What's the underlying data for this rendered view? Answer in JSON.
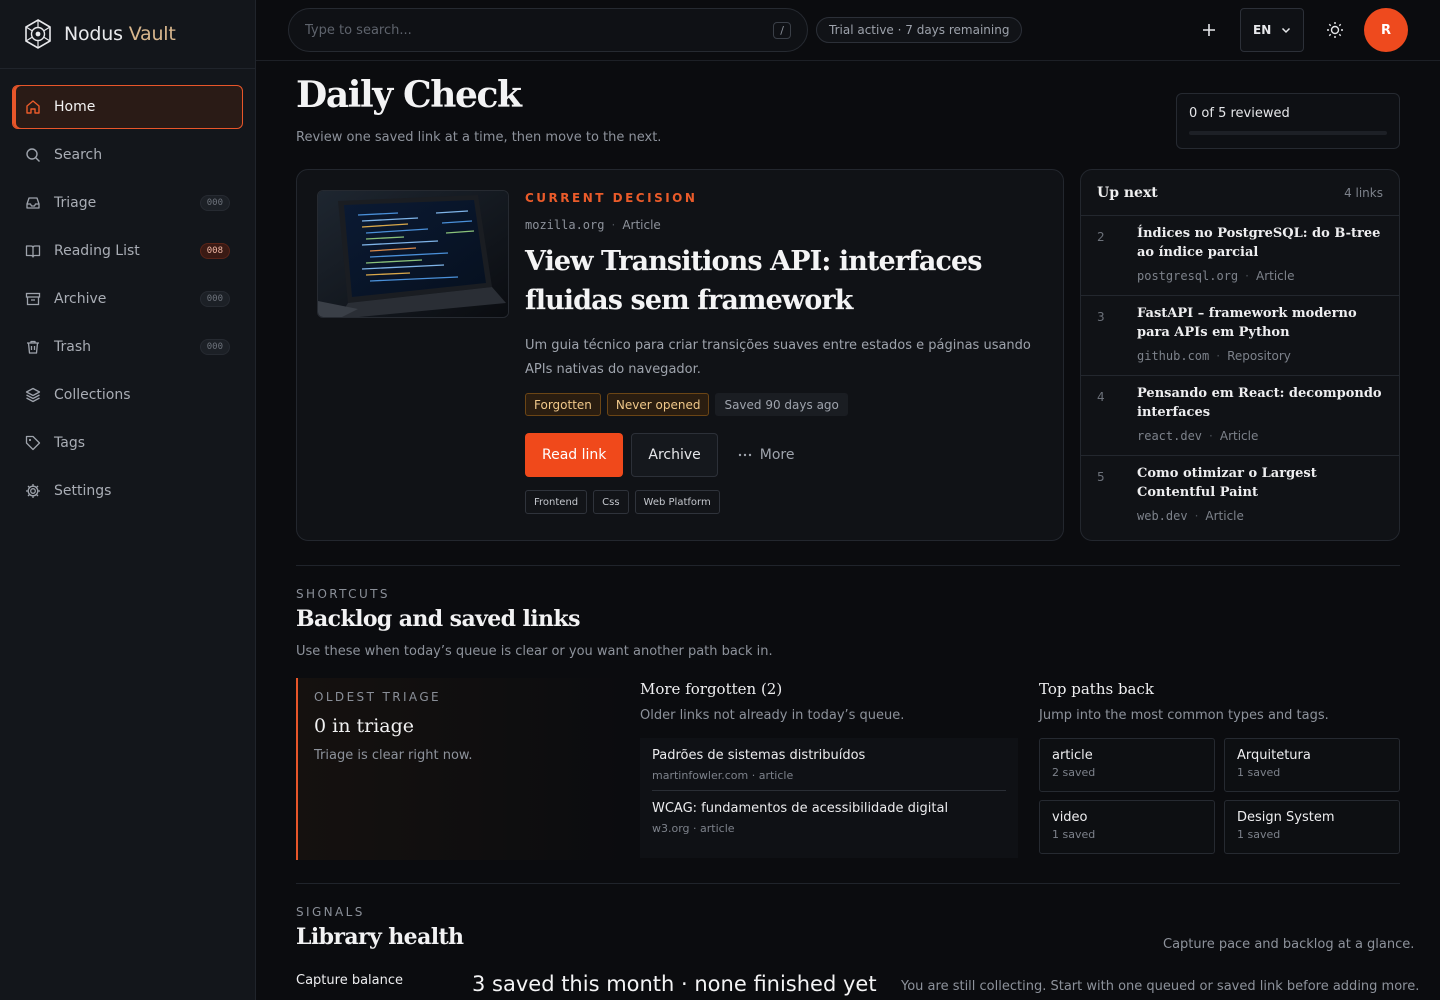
{
  "brand": {
    "name_primary": "Nodus",
    "name_accent": "Vault"
  },
  "sidebar": {
    "items": [
      {
        "label": "Home",
        "icon": "home-icon",
        "active": true
      },
      {
        "label": "Search",
        "icon": "search-icon"
      },
      {
        "label": "Triage",
        "icon": "inbox-icon",
        "badge": "000"
      },
      {
        "label": "Reading List",
        "icon": "book-open-icon",
        "badge": "008"
      },
      {
        "label": "Archive",
        "icon": "archive-icon",
        "badge": "000"
      },
      {
        "label": "Trash",
        "icon": "trash-icon",
        "badge": "000"
      },
      {
        "label": "Collections",
        "icon": "layers-icon"
      },
      {
        "label": "Tags",
        "icon": "tag-icon"
      },
      {
        "label": "Settings",
        "icon": "gear-icon"
      }
    ]
  },
  "topbar": {
    "search_placeholder": "Type to search...",
    "search_shortcut": "/",
    "trial": "Trial active · 7 days remaining",
    "language": "EN",
    "avatar_initial": "R"
  },
  "page": {
    "title": "Daily Check",
    "subtitle": "Review one saved link at a time, then move to the next.",
    "progress_label": "0 of 5 reviewed",
    "progress_fraction": 0
  },
  "decision": {
    "eyebrow": "CURRENT DECISION",
    "domain": "mozilla.org",
    "type": "Article",
    "title": "View Transitions API: interfaces fluidas sem framework",
    "summary": "Um guia técnico para criar transições suaves entre estados e páginas usando APIs nativas do navegador.",
    "badges": {
      "forgotten": "Forgotten",
      "never_opened": "Never opened",
      "saved": "Saved 90 days ago"
    },
    "read_label": "Read link",
    "archive_label": "Archive",
    "more_label": "More",
    "tags": [
      "Frontend",
      "Css",
      "Web Platform"
    ]
  },
  "upnext": {
    "title": "Up next",
    "count": "4 links",
    "items": [
      {
        "num": "2",
        "title": "Índices no PostgreSQL: do B-tree ao índice parcial",
        "domain": "postgresql.org",
        "type": "Article"
      },
      {
        "num": "3",
        "title": "FastAPI – framework moderno para APIs em Python",
        "domain": "github.com",
        "type": "Repository"
      },
      {
        "num": "4",
        "title": "Pensando em React: decompondo interfaces",
        "domain": "react.dev",
        "type": "Article"
      },
      {
        "num": "5",
        "title": "Como otimizar o Largest Contentful Paint",
        "domain": "web.dev",
        "type": "Article"
      }
    ]
  },
  "shortcuts": {
    "eyebrow": "SHORTCUTS",
    "title": "Backlog and saved links",
    "subtitle": "Use these when today’s queue is clear or you want another path back in.",
    "triage": {
      "eyebrow": "OLDEST TRIAGE",
      "count": "0 in triage",
      "message": "Triage is clear right now."
    },
    "forgotten": {
      "title": "More forgotten (2)",
      "subtitle": "Older links not already in today’s queue.",
      "items": [
        {
          "title": "Padrões de sistemas distribuídos",
          "meta": "martinfowler.com · article"
        },
        {
          "title": "WCAG: fundamentos de acessibilidade digital",
          "meta": "w3.org · article"
        }
      ]
    },
    "paths": {
      "title": "Top paths back",
      "subtitle": "Jump into the most common types and tags.",
      "items": [
        {
          "name": "article",
          "count": "2 saved"
        },
        {
          "name": "Arquitetura",
          "count": "1 saved"
        },
        {
          "name": "video",
          "count": "1 saved"
        },
        {
          "name": "Design System",
          "count": "1 saved"
        }
      ]
    }
  },
  "signals": {
    "eyebrow": "SIGNALS",
    "title": "Library health",
    "note": "Capture pace and backlog at a glance.",
    "capture_label": "Capture balance",
    "capture_stat": "3 saved this month · none finished yet",
    "capture_desc": "You are still collecting. Start with one queued or saved link before adding more."
  },
  "colors": {
    "accent": "#e8562a",
    "background": "#0b0c0f",
    "sidebar": "#13161b"
  }
}
